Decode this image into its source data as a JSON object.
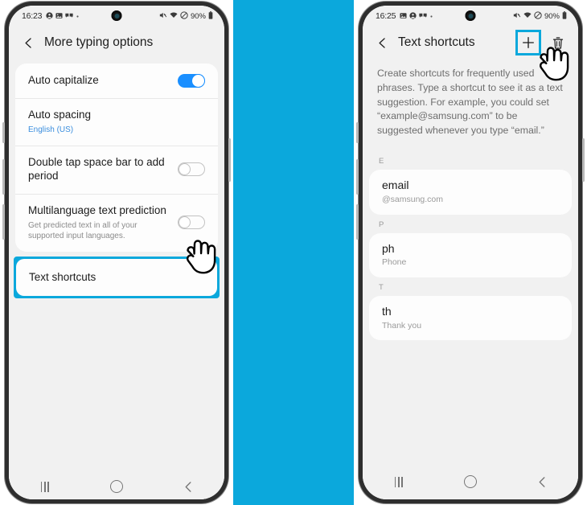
{
  "theme": {
    "accent_cyan": "#0BA8DC",
    "toggle_on": "#1A8FFF",
    "link_blue": "#3B8EDE",
    "page_bg": "#F1F1F1",
    "card_bg": "#FDFDFD"
  },
  "panels": {
    "left": {
      "status_bar": {
        "time": "16:23",
        "left_icons": [
          "person-circle-icon",
          "image-icon",
          "dual-message-icon",
          "dot-icon"
        ],
        "right_icons": [
          "mute-icon",
          "wifi-icon",
          "do-not-disturb-icon"
        ],
        "battery_text": "90%",
        "battery_icon": "battery-icon"
      },
      "appbar": {
        "back_icon": "back-chevron-icon",
        "title": "More typing options"
      },
      "settings": [
        {
          "title": "Auto capitalize",
          "subtitle": "",
          "control": "toggle",
          "toggle_state": "on"
        },
        {
          "title": "Auto spacing",
          "subtitle": "English (US)",
          "subtitle_style": "blue",
          "control": "none"
        },
        {
          "title": "Double tap space bar to add period",
          "subtitle": "",
          "control": "toggle",
          "toggle_state": "off"
        },
        {
          "title": "Multilanguage text prediction",
          "subtitle": "Get predicted text in all of your supported input languages.",
          "control": "toggle",
          "toggle_state": "off"
        }
      ],
      "highlighted_row": {
        "title": "Text shortcuts",
        "highlight_color": "#0BA8DC"
      },
      "cursor": "pointing-hand-cursor",
      "nav_bar": {
        "recents_label": "recents-icon",
        "home_label": "home-icon",
        "back_label": "back-icon"
      }
    },
    "right": {
      "status_bar": {
        "time": "16:25",
        "left_icons": [
          "image-icon",
          "person-circle-icon",
          "dual-message-icon",
          "dot-icon"
        ],
        "right_icons": [
          "mute-icon",
          "wifi-icon",
          "do-not-disturb-icon"
        ],
        "battery_text": "90%",
        "battery_icon": "battery-icon"
      },
      "appbar": {
        "back_icon": "back-chevron-icon",
        "title": "Text shortcuts",
        "add_icon": "plus-icon",
        "delete_icon": "trash-icon",
        "highlighted_action": "plus-icon"
      },
      "description": "Create shortcuts for frequently used phrases. Type a shortcut to see it as a text suggestion. For example, you could set “example@samsung.com” to be suggested whenever you type “email.”",
      "sections": [
        {
          "letter": "E",
          "items": [
            {
              "shortcut": "email",
              "expansion": "@samsung.com"
            }
          ]
        },
        {
          "letter": "P",
          "items": [
            {
              "shortcut": "ph",
              "expansion": "Phone"
            }
          ]
        },
        {
          "letter": "T",
          "items": [
            {
              "shortcut": "th",
              "expansion": "Thank you"
            }
          ]
        }
      ],
      "cursor": "pointing-hand-cursor",
      "nav_bar": {
        "recents_label": "recents-icon",
        "home_label": "home-icon",
        "back_label": "back-icon"
      }
    }
  }
}
